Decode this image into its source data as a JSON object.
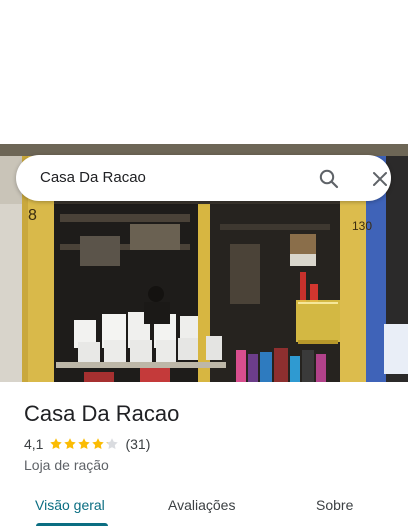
{
  "search": {
    "value": "Casa Da Racao"
  },
  "icons": {
    "search": "search-icon",
    "close": "close-icon",
    "star": "star-icon"
  },
  "place": {
    "name": "Casa Da Racao",
    "rating": "4,1",
    "rating_value": 4.1,
    "stars_max": 5,
    "review_count": "(31)",
    "category": "Loja de ração"
  },
  "tabs": [
    {
      "label": "Visão geral",
      "active": true
    },
    {
      "label": "Avaliações",
      "active": false
    },
    {
      "label": "Sobre",
      "active": false
    }
  ],
  "colors": {
    "accent": "#0b6e82",
    "star_filled": "#fbbc04",
    "star_empty": "#dadce0"
  }
}
